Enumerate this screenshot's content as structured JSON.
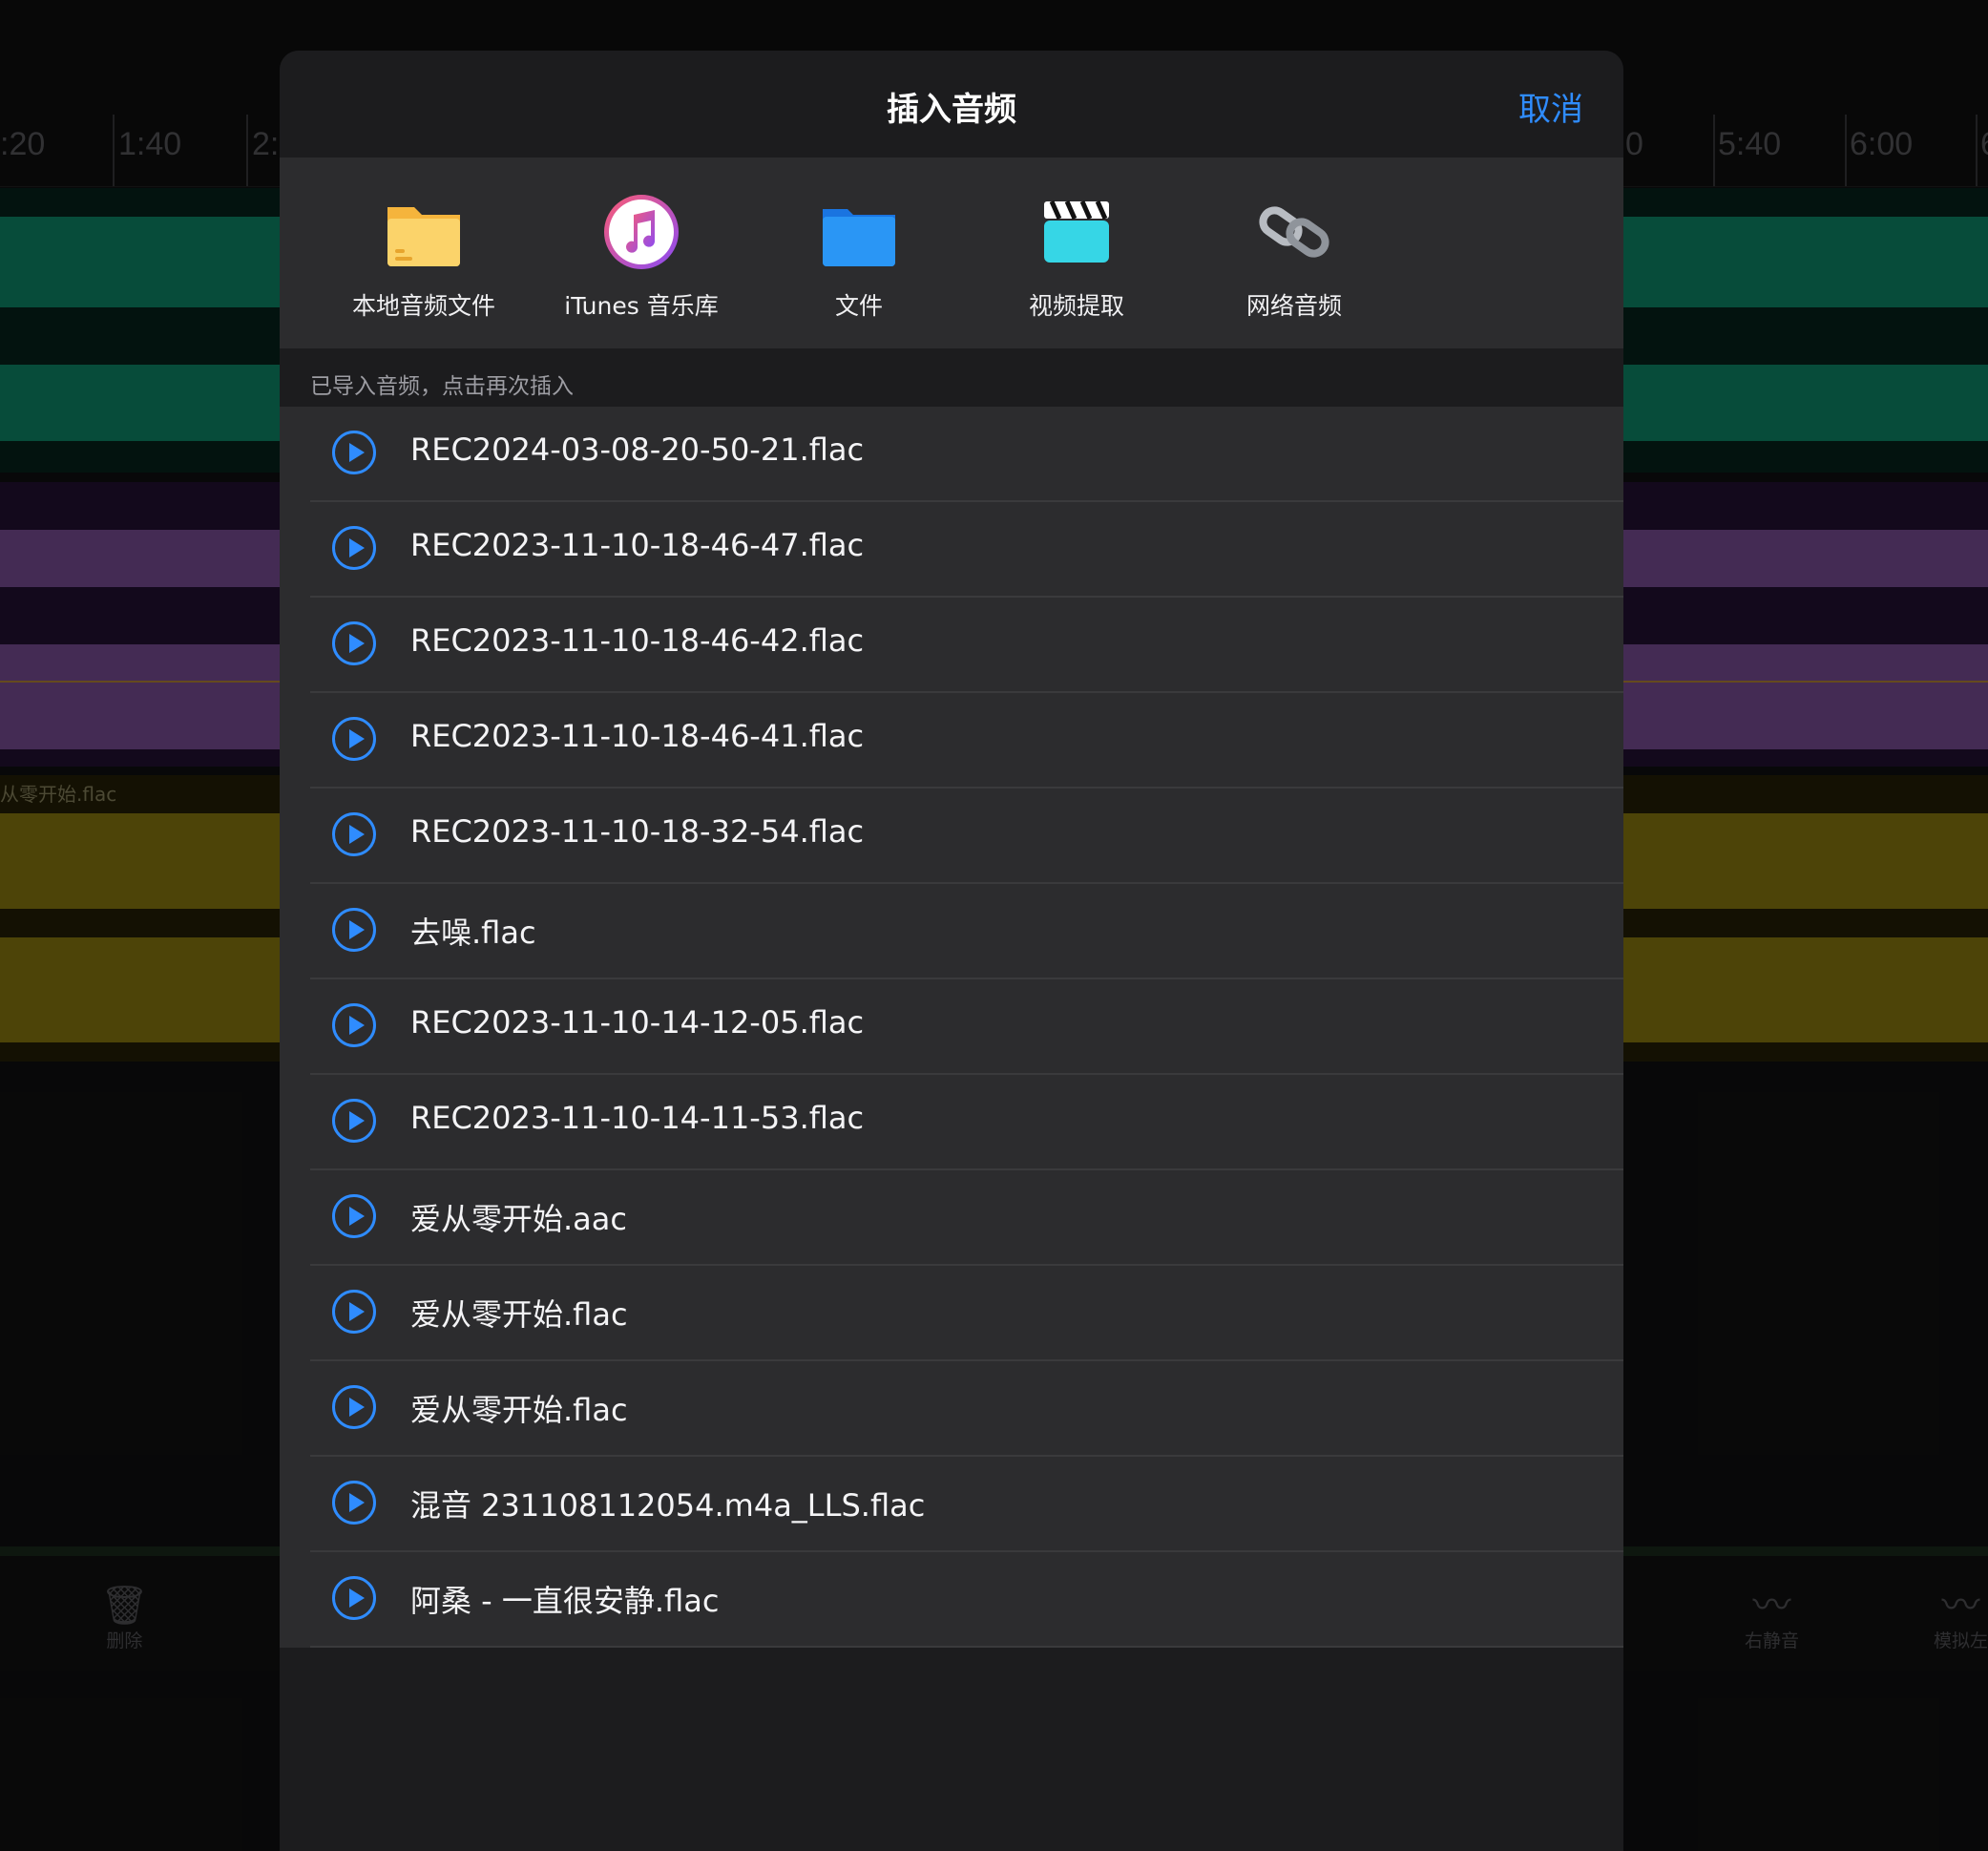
{
  "background": {
    "ruler_ticks": [
      ":20",
      "1:40",
      "2:",
      "0",
      "5:40",
      "6:00",
      "6"
    ],
    "track_label": "从零开始.flac",
    "tools": [
      {
        "label": "删除",
        "icon": "trash-icon"
      },
      {
        "label": "右静音",
        "icon": "right-mute-icon"
      },
      {
        "label": "模拟左",
        "icon": "simulate-left-icon"
      }
    ]
  },
  "modal": {
    "title": "插入音频",
    "cancel_label": "取消",
    "sources": [
      {
        "label": "本地音频文件",
        "icon": "folder-icon"
      },
      {
        "label": "iTunes 音乐库",
        "icon": "itunes-icon"
      },
      {
        "label": "文件",
        "icon": "files-icon"
      },
      {
        "label": "视频提取",
        "icon": "video-clapper-icon"
      },
      {
        "label": "网络音频",
        "icon": "link-icon"
      }
    ],
    "section_title": "已导入音频，点击再次插入",
    "files": [
      "REC2024-03-08-20-50-21.flac",
      "REC2023-11-10-18-46-47.flac",
      "REC2023-11-10-18-46-42.flac",
      "REC2023-11-10-18-46-41.flac",
      "REC2023-11-10-18-32-54.flac",
      "去噪.flac",
      "REC2023-11-10-14-12-05.flac",
      "REC2023-11-10-14-11-53.flac",
      "爱从零开始.aac",
      "爱从零开始.flac",
      "爱从零开始.flac",
      "混音 231108112054.m4a_LLS.flac",
      "阿桑 - 一直很安静.flac"
    ]
  },
  "colors": {
    "accent": "#2f8cff",
    "track_green": "#0d8a6a",
    "track_purple": "#8a5aa8",
    "track_yellow": "#8c7c10"
  }
}
